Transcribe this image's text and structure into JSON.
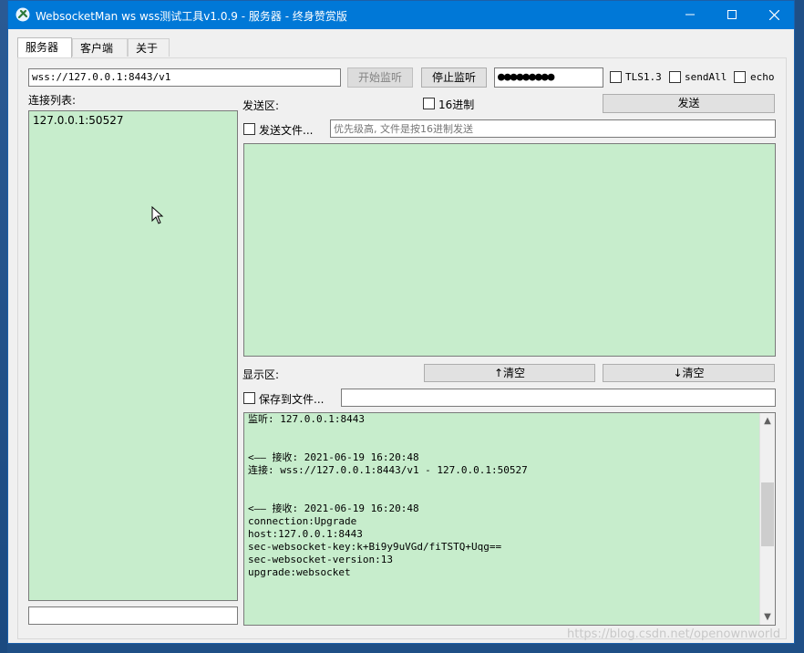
{
  "window": {
    "title": "WebsocketMan ws wss测试工具v1.0.9  - 服务器 - 终身赞赏版",
    "minimize_icon": "minimize-icon",
    "maximize_icon": "maximize-icon",
    "close_icon": "close-icon"
  },
  "tabs": [
    {
      "label": "服务器",
      "active": true
    },
    {
      "label": "客户端",
      "active": false
    },
    {
      "label": "关于",
      "active": false
    }
  ],
  "server": {
    "url": "wss://127.0.0.1:8443/v1",
    "start_label": "开始监听",
    "stop_label": "停止监听",
    "password_mask": "●●●●●●●●●",
    "tls_label": "TLS1.3",
    "sendall_label": "sendAll",
    "echo_label": "echo"
  },
  "connections": {
    "label": "连接列表:",
    "items": [
      "127.0.0.1:50527"
    ],
    "bottom_input": ""
  },
  "send": {
    "label": "发送区:",
    "hex_label": "16进制",
    "send_button": "发送",
    "send_file_label": "发送文件...",
    "file_placeholder": "优先级高, 文件是按16进制发送",
    "content": ""
  },
  "display": {
    "label": "显示区:",
    "clear_up": "↑清空",
    "clear_down": "↓清空",
    "save_file_label": "保存到文件...",
    "save_path": "",
    "log": [
      "监听: 127.0.0.1:8443",
      "",
      "",
      "<—— 接收: 2021-06-19 16:20:48",
      "连接: wss://127.0.0.1:8443/v1 - 127.0.0.1:50527",
      "",
      "",
      "<—— 接收: 2021-06-19 16:20:48",
      "connection:Upgrade",
      "host:127.0.0.1:8443",
      "sec-websocket-key:k+Bi9y9uVGd/fiTSTQ+Uqg==",
      "sec-websocket-version:13",
      "upgrade:websocket"
    ]
  },
  "colors": {
    "titlebar": "#0078d7",
    "green_panel": "#c7edcc"
  },
  "watermark": "https://blog.csdn.net/openownworld"
}
